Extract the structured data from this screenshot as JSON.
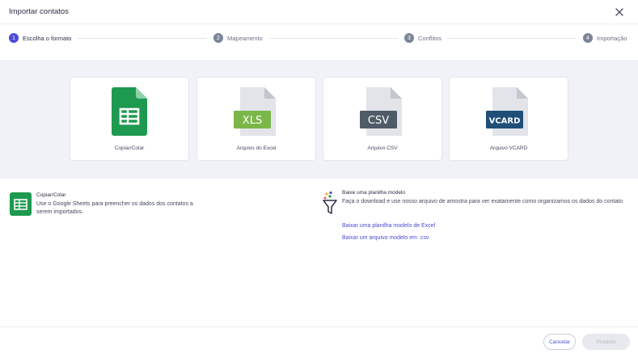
{
  "dialog": {
    "title": "Importar contatos",
    "close_icon": "close-icon"
  },
  "steps": [
    {
      "number": "1",
      "label": "Escolha o formato",
      "active": true
    },
    {
      "number": "2",
      "label": "Mapeamento",
      "active": false
    },
    {
      "number": "3",
      "label": "Conflitos",
      "active": false
    },
    {
      "number": "4",
      "label": "Importação",
      "active": false
    }
  ],
  "formats": [
    {
      "caption": "Copiar/Colar",
      "icon": "google-sheets-icon",
      "badge": ""
    },
    {
      "caption": "Arquivo do Excel",
      "icon": "xls-file-icon",
      "badge": "XLS"
    },
    {
      "caption": "Arquivo CSV",
      "icon": "csv-file-icon",
      "badge": "CSV"
    },
    {
      "caption": "Arquivo VCARD",
      "icon": "vcard-file-icon",
      "badge": "VCARD"
    }
  ],
  "selected_info": {
    "icon": "google-sheets-icon",
    "title": "Copiar/Colar",
    "description": "Use o Google Sheets para preencher os dados dos contatos a serem importados."
  },
  "template_info": {
    "icon": "funnel-icon",
    "title": "Baixe uma planilha modelo",
    "description": "Faça o download e use nosso arquivo de amostra para ver exatamente como organizamos os dados do contato",
    "links": [
      "Baixar uma planilha modelo de Excel",
      "Baixar um arquivo modelo em .csv"
    ]
  },
  "footer": {
    "cancel_label": "Cancelar",
    "next_label": "Próximo"
  },
  "colors": {
    "accent": "#4b4bd8",
    "sheets_green": "#1e9a50",
    "xls_green": "#7ab648",
    "csv_slate": "#4f5b66",
    "vcard_blue": "#1f4e79",
    "panel_bg": "#f0f2f7"
  }
}
